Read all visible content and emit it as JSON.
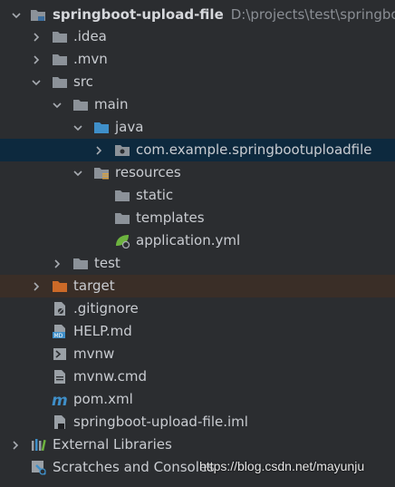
{
  "project": {
    "name": "springboot-upload-file",
    "path": "D:\\projects\\test\\springboot-upload-file"
  },
  "tree": {
    "idea": ".idea",
    "mvn": ".mvn",
    "src": "src",
    "main": "main",
    "java": "java",
    "package": "com.example.springbootuploadfile",
    "resources": "resources",
    "static": "static",
    "templates": "templates",
    "app_yml": "application.yml",
    "test": "test",
    "target": "target",
    "gitignore": ".gitignore",
    "help": "HELP.md",
    "mvnw": "mvnw",
    "mvnw_cmd": "mvnw.cmd",
    "pom": "pom.xml",
    "iml": "springboot-upload-file.iml",
    "external_libs": "External Libraries",
    "scratches": "Scratches and Consoles"
  },
  "watermark": "https://blog.csdn.net/mayunju",
  "colors": {
    "folder": "#8c9299",
    "source_folder": "#3f8fc9",
    "excluded_folder": "#cc6a28",
    "selected_bg": "#0d293e"
  }
}
